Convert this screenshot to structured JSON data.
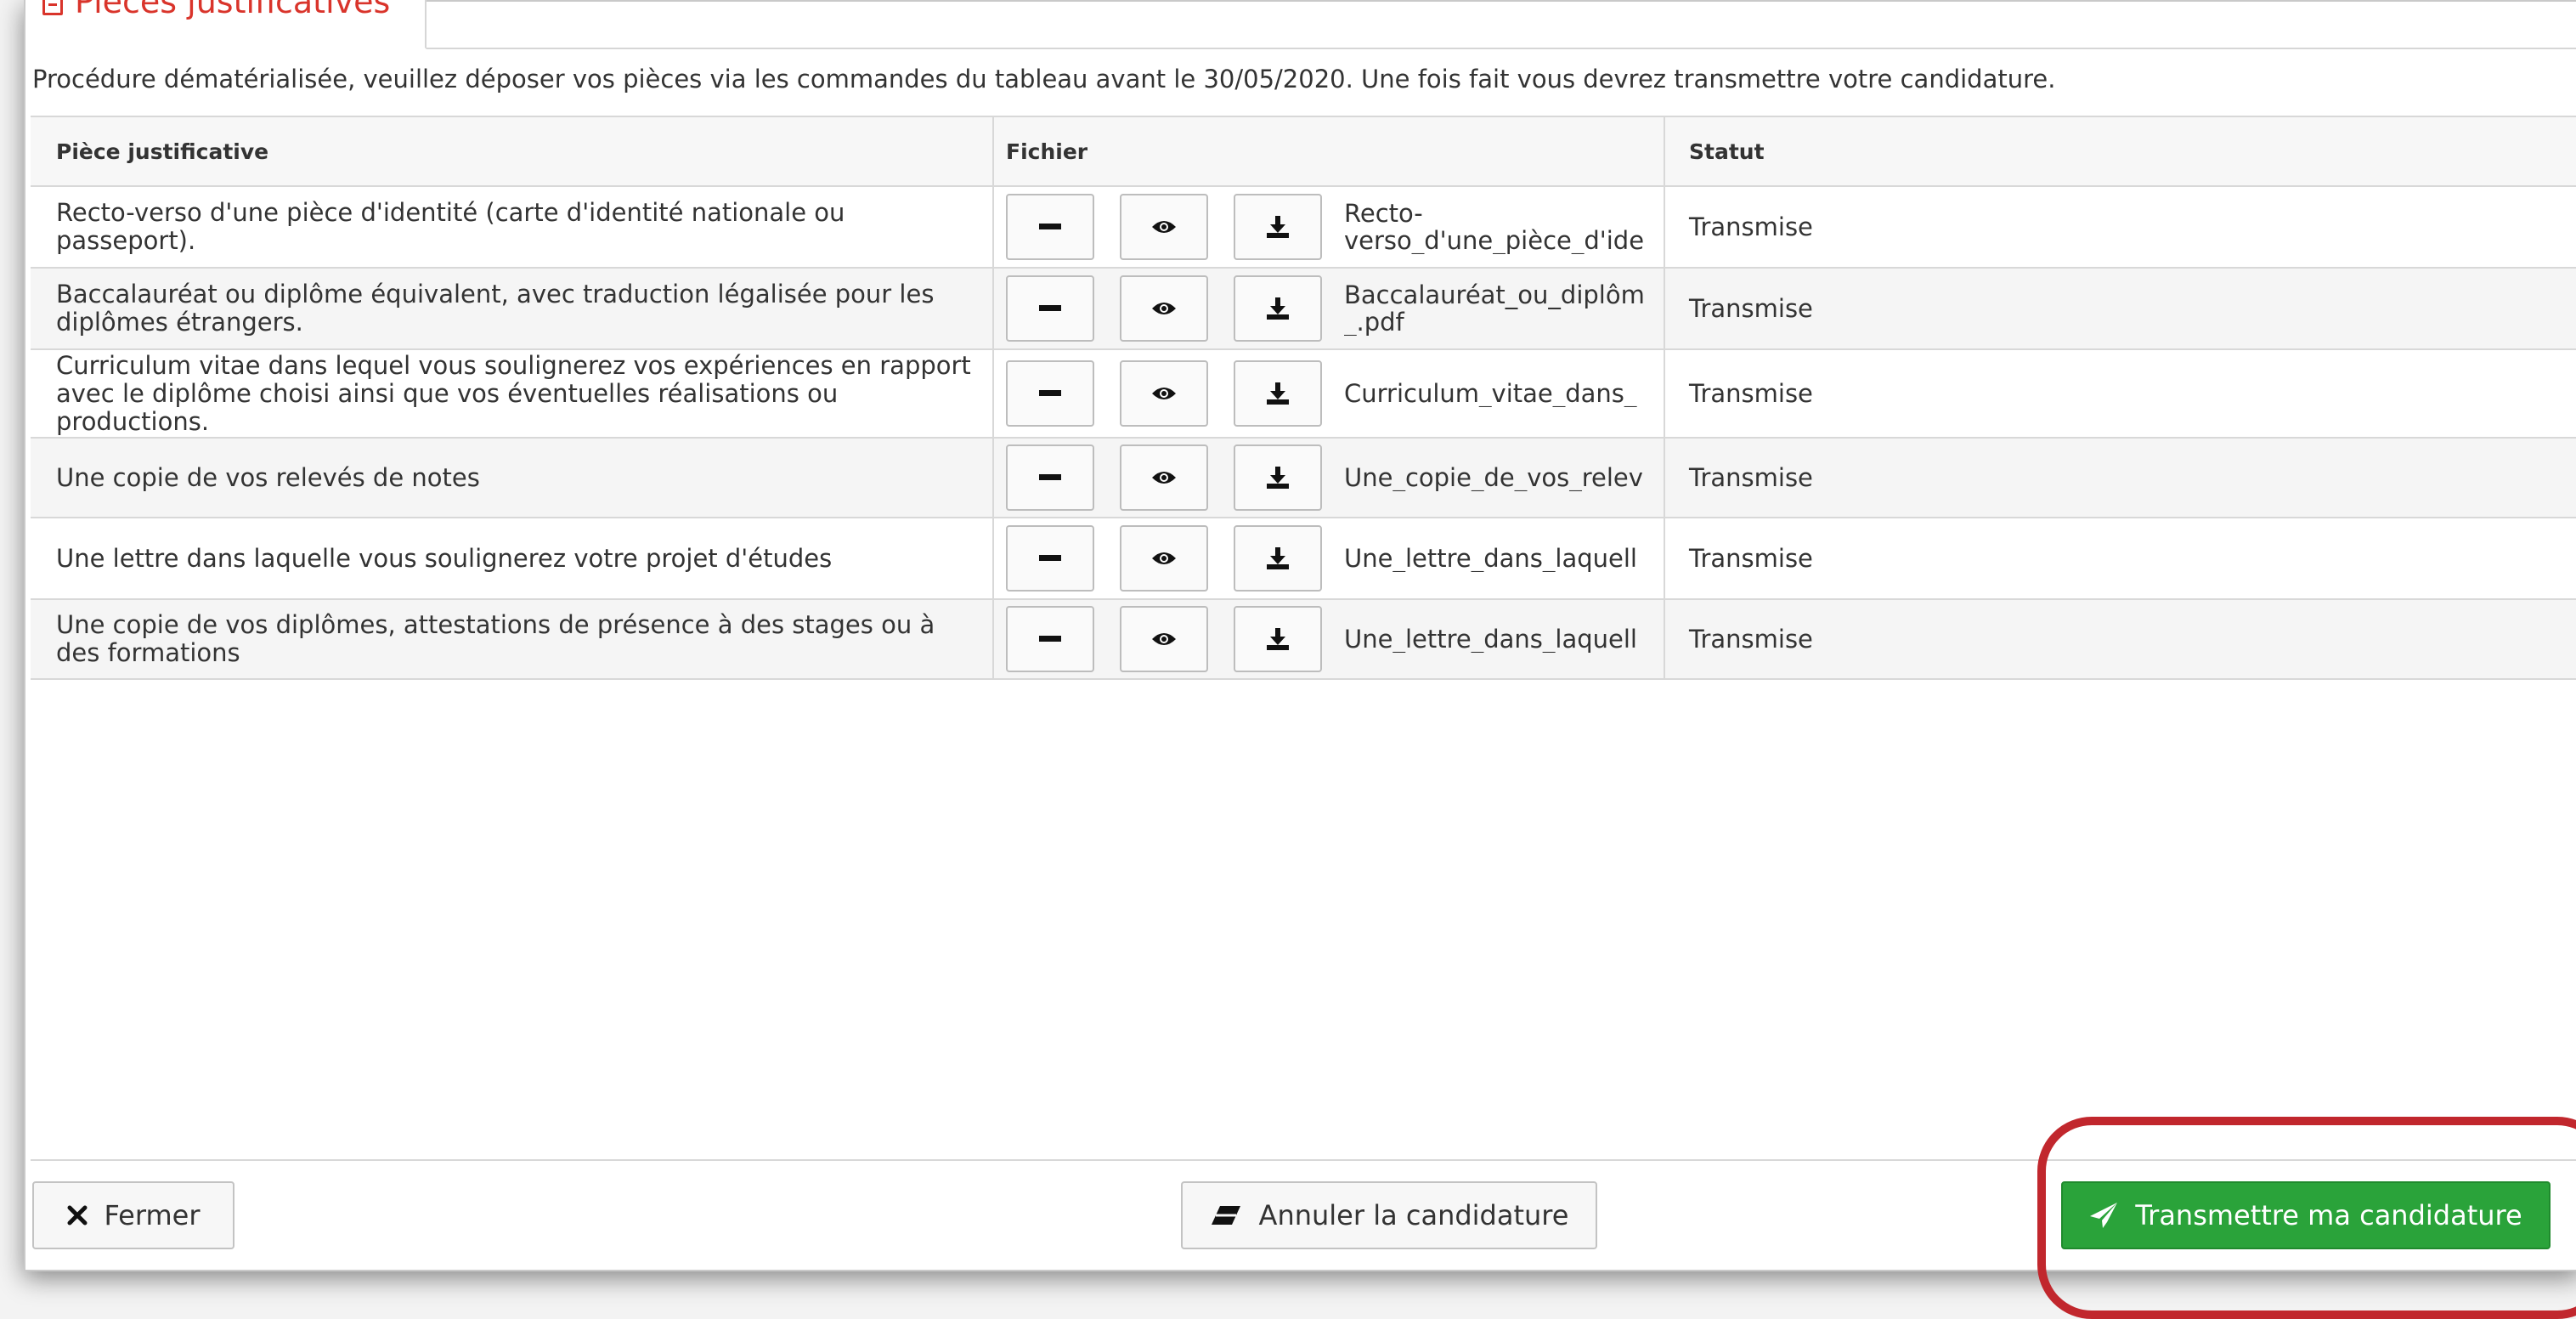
{
  "tab": {
    "label": "Pièces justificatives"
  },
  "intro_text": "Procédure dématérialisée, veuillez déposer vos pièces via les commandes du tableau avant le 30/05/2020. Une fois fait vous devrez transmettre votre candidature.",
  "table": {
    "headers": {
      "piece": "Pièce justificative",
      "fichier": "Fichier",
      "statut": "Statut"
    },
    "rows": [
      {
        "piece": "Recto-verso d'une pièce d'identité (carte d'identité nationale ou passeport).",
        "file_line1": "Recto-",
        "file_line2": "verso_d'une_pièce_d'ide",
        "status": "Transmise"
      },
      {
        "piece": "Baccalauréat ou diplôme équivalent, avec traduction légalisée pour les diplômes étrangers.",
        "file_line1": "Baccalauréat_ou_diplôm",
        "file_line2": "_.pdf",
        "status": "Transmise"
      },
      {
        "piece": "Curriculum vitae dans lequel vous soulignerez vos expériences en rapport avec le diplôme choisi ainsi que vos éventuelles réalisations ou productions.",
        "file_line1": "Curriculum_vitae_dans_",
        "file_line2": "",
        "status": "Transmise"
      },
      {
        "piece": "Une copie de vos relevés de notes",
        "file_line1": "Une_copie_de_vos_relev",
        "file_line2": "",
        "status": "Transmise"
      },
      {
        "piece": "Une lettre dans laquelle vous soulignerez votre projet d'études",
        "file_line1": "Une_lettre_dans_laquell",
        "file_line2": "",
        "status": "Transmise"
      },
      {
        "piece": "Une copie de vos diplômes, attestations de présence à des stages ou à des formations",
        "file_line1": "Une_lettre_dans_laquell",
        "file_line2": "",
        "status": "Transmise"
      }
    ]
  },
  "icons": {
    "remove": "minus-icon",
    "view": "eye-icon",
    "download": "download-icon",
    "close": "times-icon",
    "cancel": "eraser-icon",
    "send": "paper-plane-icon"
  },
  "buttons": {
    "close": "Fermer",
    "cancel": "Annuler la candidature",
    "submit": "Transmettre ma candidature"
  },
  "colors": {
    "accent_red": "#d9342b",
    "submit_green": "#2aa33a",
    "highlight_red": "#c1272d"
  }
}
